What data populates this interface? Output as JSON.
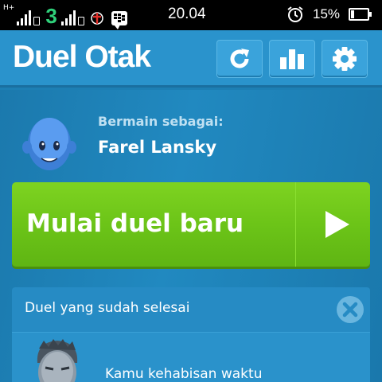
{
  "status_bar": {
    "net_tag": "H+",
    "carrier_digit": "3",
    "time": "20.04",
    "battery": "15%",
    "icons": [
      "signal-icon",
      "sim-icon",
      "telkomsel-icon",
      "bbm-icon",
      "alarm-icon",
      "battery-icon"
    ]
  },
  "header": {
    "title": "Duel Otak",
    "buttons": [
      {
        "name": "refresh",
        "icon": "refresh-icon"
      },
      {
        "name": "statistics",
        "icon": "bar-chart-icon"
      },
      {
        "name": "settings",
        "icon": "gear-icon"
      }
    ]
  },
  "profile": {
    "label": "Bermain sebagai:",
    "name": "Farel Lansky"
  },
  "start_button": {
    "label": "Mulai duel baru",
    "icon": "play-icon"
  },
  "finished": {
    "title": "Duel yang sudah selesai",
    "clear_icon": "close-circle-icon",
    "items": [
      {
        "status": "Kamu kehabisan waktu"
      }
    ]
  },
  "colors": {
    "background": "#1d7fb4",
    "header": "#2a93cc",
    "start_green": "#6cc418"
  }
}
